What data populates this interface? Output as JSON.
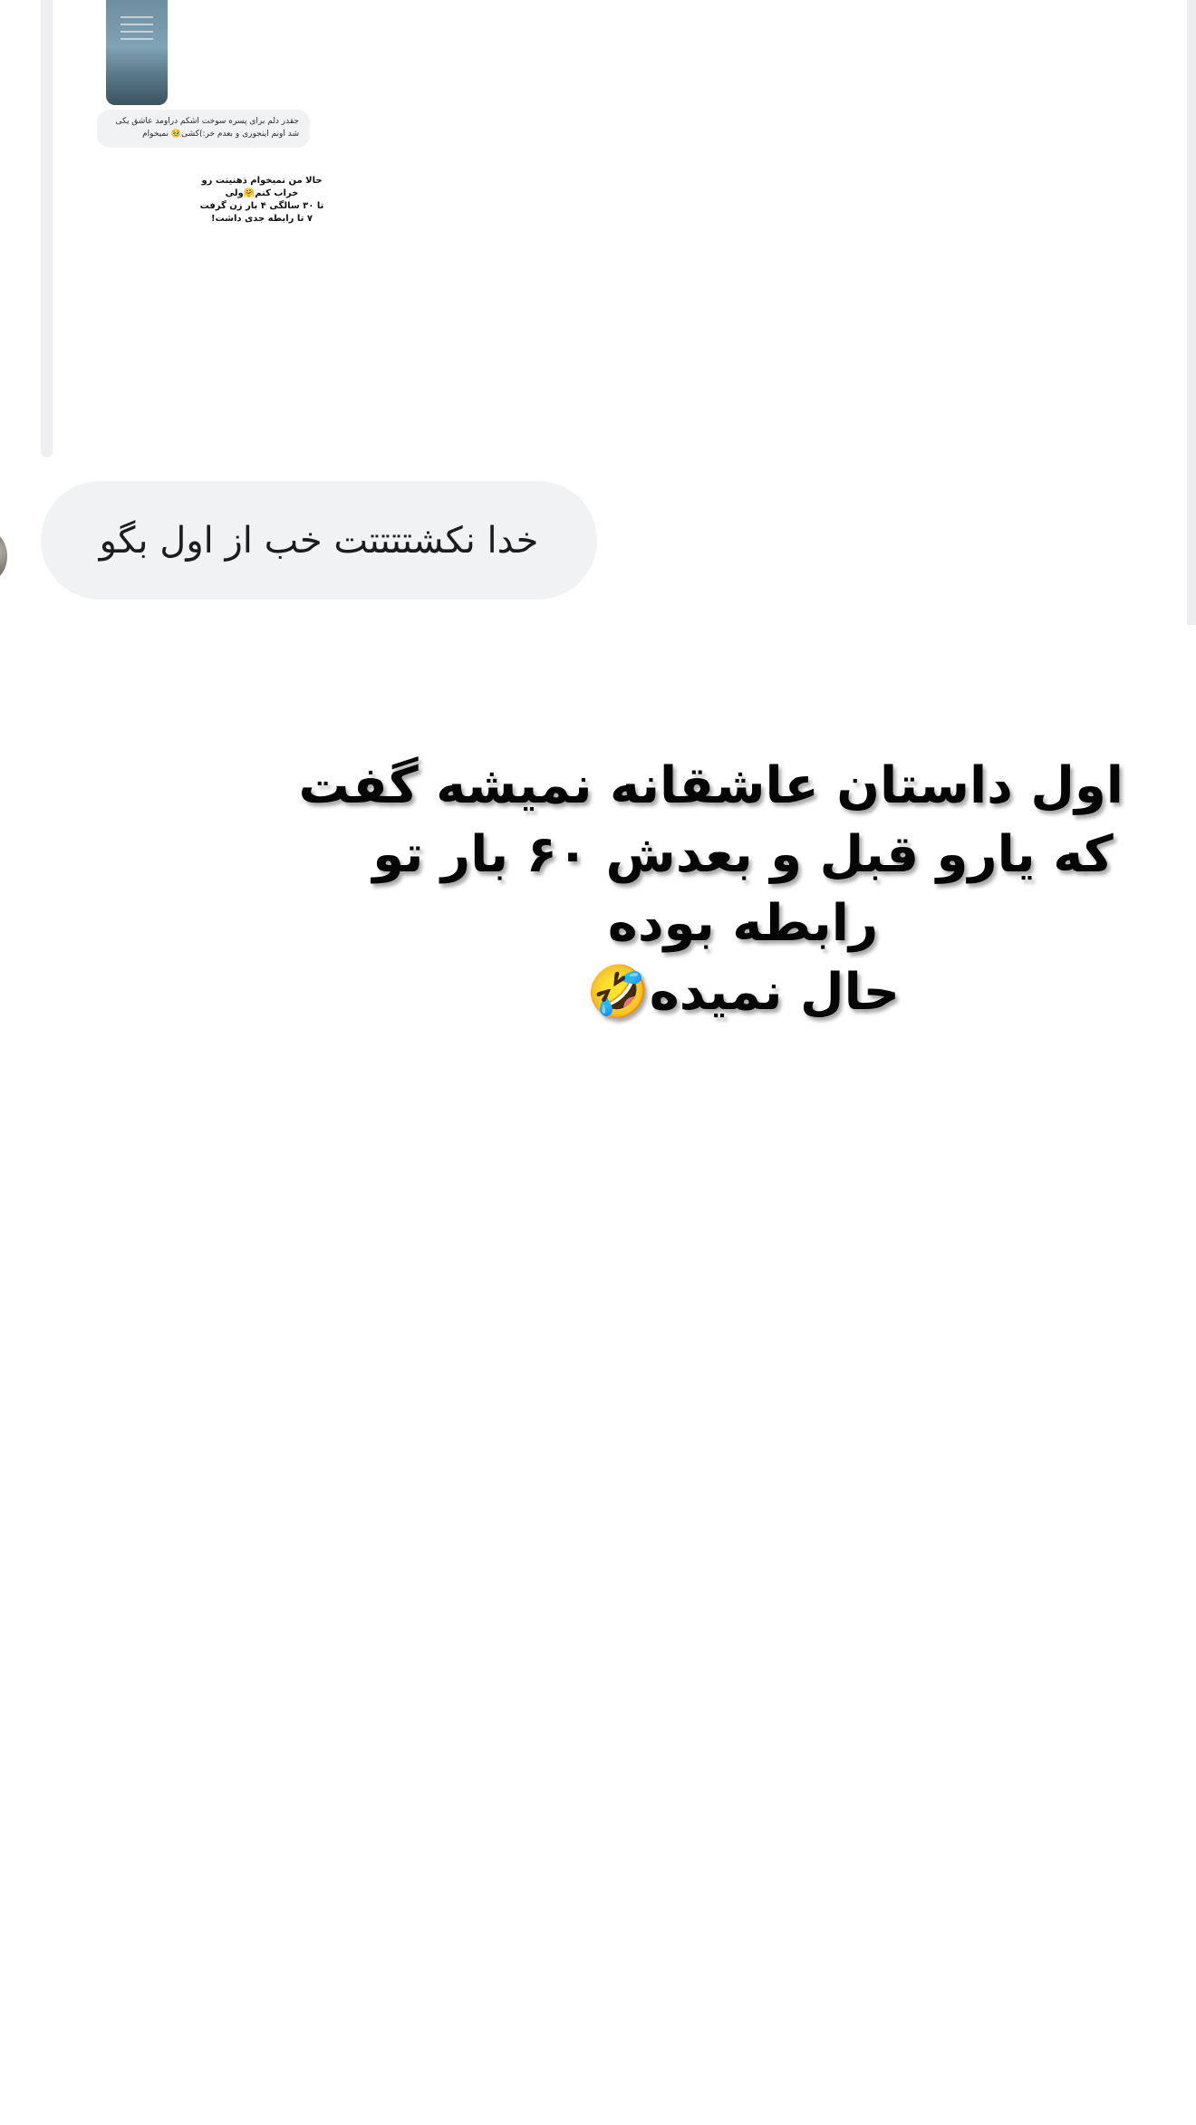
{
  "reply_thread": {
    "story_thumbnail_icon": "story-image-thumbnail",
    "tiny_bubble_lines": [
      "جقدر دلم برای پسره سوخت اشکم دراومد عاشق یکی",
      "شد اونم اینجوری و بعدم خر:)کشی🥹 نمیخوام"
    ],
    "caption_lines": [
      "حالا من نمیخوام ذهنیتت رو",
      "خراب کنم🤗ولی",
      "تا ۳۰ سالگی ۴ بار زن گرفت",
      "۷ تا رابطه جدی داشت!"
    ]
  },
  "message": {
    "text": "خدا نکشتتتتت خب از اول بگو",
    "bubble_color": "#f1f2f4"
  },
  "overlay": {
    "lines": [
      "اول داستان عاشقانه نمیشه گفت",
      "که یارو قبل و بعدش ۶۰ بار تو",
      "رابطه بوده",
      "حال نمیده🤣"
    ]
  }
}
